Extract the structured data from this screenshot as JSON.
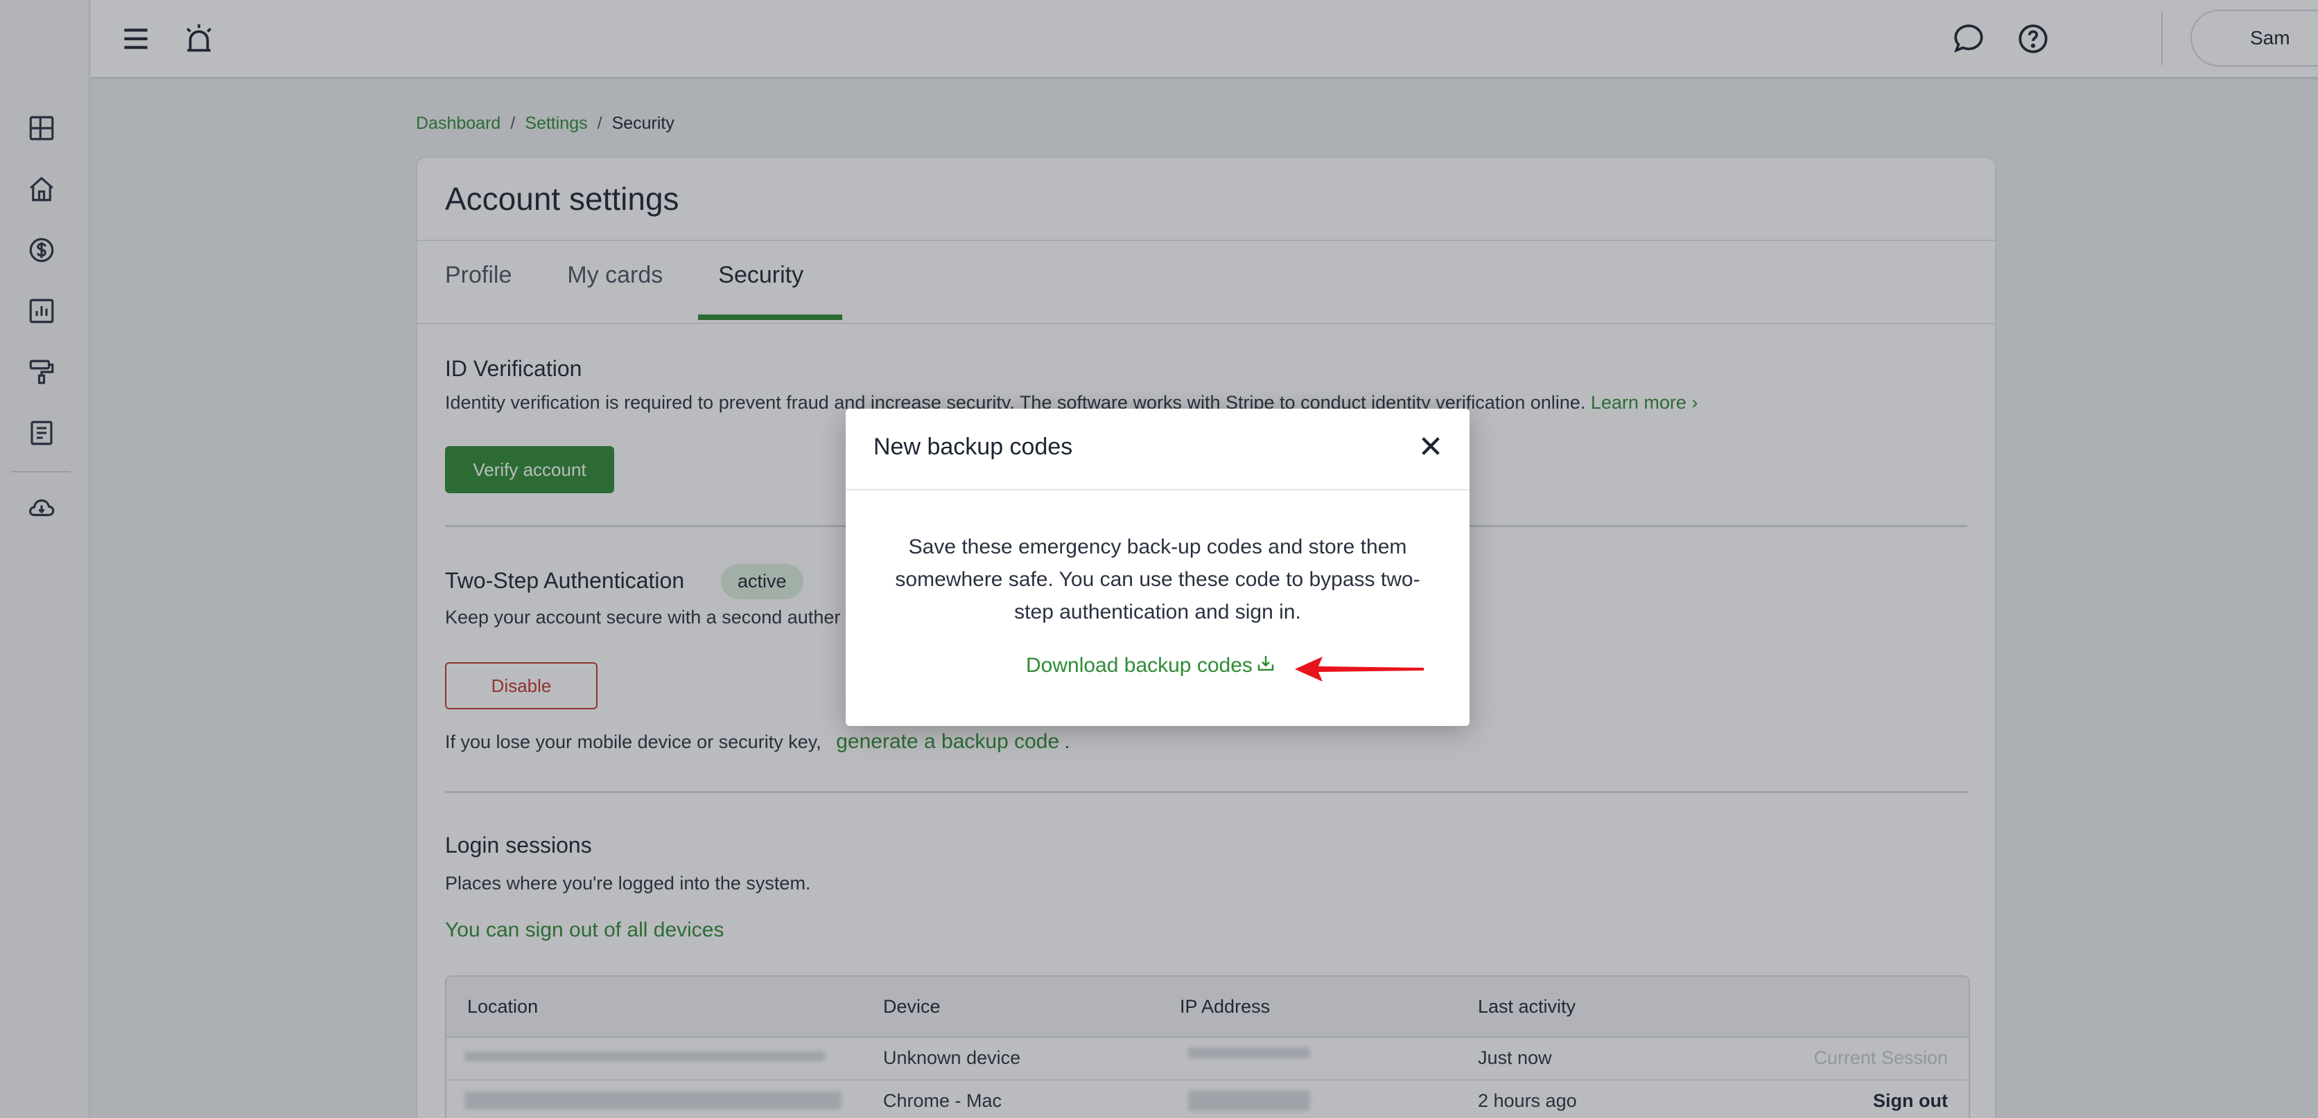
{
  "topbar": {
    "user_name": "Sam"
  },
  "breadcrumb": {
    "items": [
      "Dashboard",
      "Settings",
      "Security"
    ],
    "separator": "/"
  },
  "card": {
    "title": "Account settings",
    "tabs": [
      "Profile",
      "My cards",
      "Security"
    ],
    "active_tab": "Security"
  },
  "id_verification": {
    "title": "ID Verification",
    "text": "Identity verification is required to prevent fraud and increase security. The software works with Stripe to conduct identity verification online.",
    "learn_more": "Learn more",
    "button": "Verify account"
  },
  "two_step": {
    "title": "Two-Step Authentication",
    "badge": "active",
    "text_visible": "Keep your account secure with a second auther",
    "button": "Disable",
    "lose_text": "If you lose your mobile device or security key,",
    "backup_link": "generate a backup code",
    "period": "."
  },
  "login_sessions": {
    "title": "Login sessions",
    "text": "Places where you're logged into the system.",
    "sign_out_all": "You can sign out of all devices",
    "columns": [
      "Location",
      "Device",
      "IP Address",
      "Last activity"
    ],
    "rows": [
      {
        "device": "Unknown device",
        "last_activity": "Just now",
        "action": "Current Session"
      },
      {
        "device": "Chrome - Mac",
        "last_activity": "2 hours ago",
        "action": "Sign out"
      }
    ]
  },
  "modal": {
    "title": "New backup codes",
    "body": "Save these emergency back-up codes and store them somewhere safe. You can use these code to bypass two-step authentication and sign in.",
    "download_label": "Download backup codes"
  },
  "colors": {
    "accent": "#2e8b34",
    "danger": "#c0392b",
    "arrow": "#e8141c"
  },
  "icons": {
    "sidebar": [
      "dashboard-icon",
      "home-icon",
      "dollar-icon",
      "chart-icon",
      "paint-roller-icon",
      "document-icon",
      "cloud-download-icon"
    ],
    "topbar": [
      "menu-icon",
      "alarm-icon",
      "chat-icon",
      "help-icon"
    ]
  }
}
